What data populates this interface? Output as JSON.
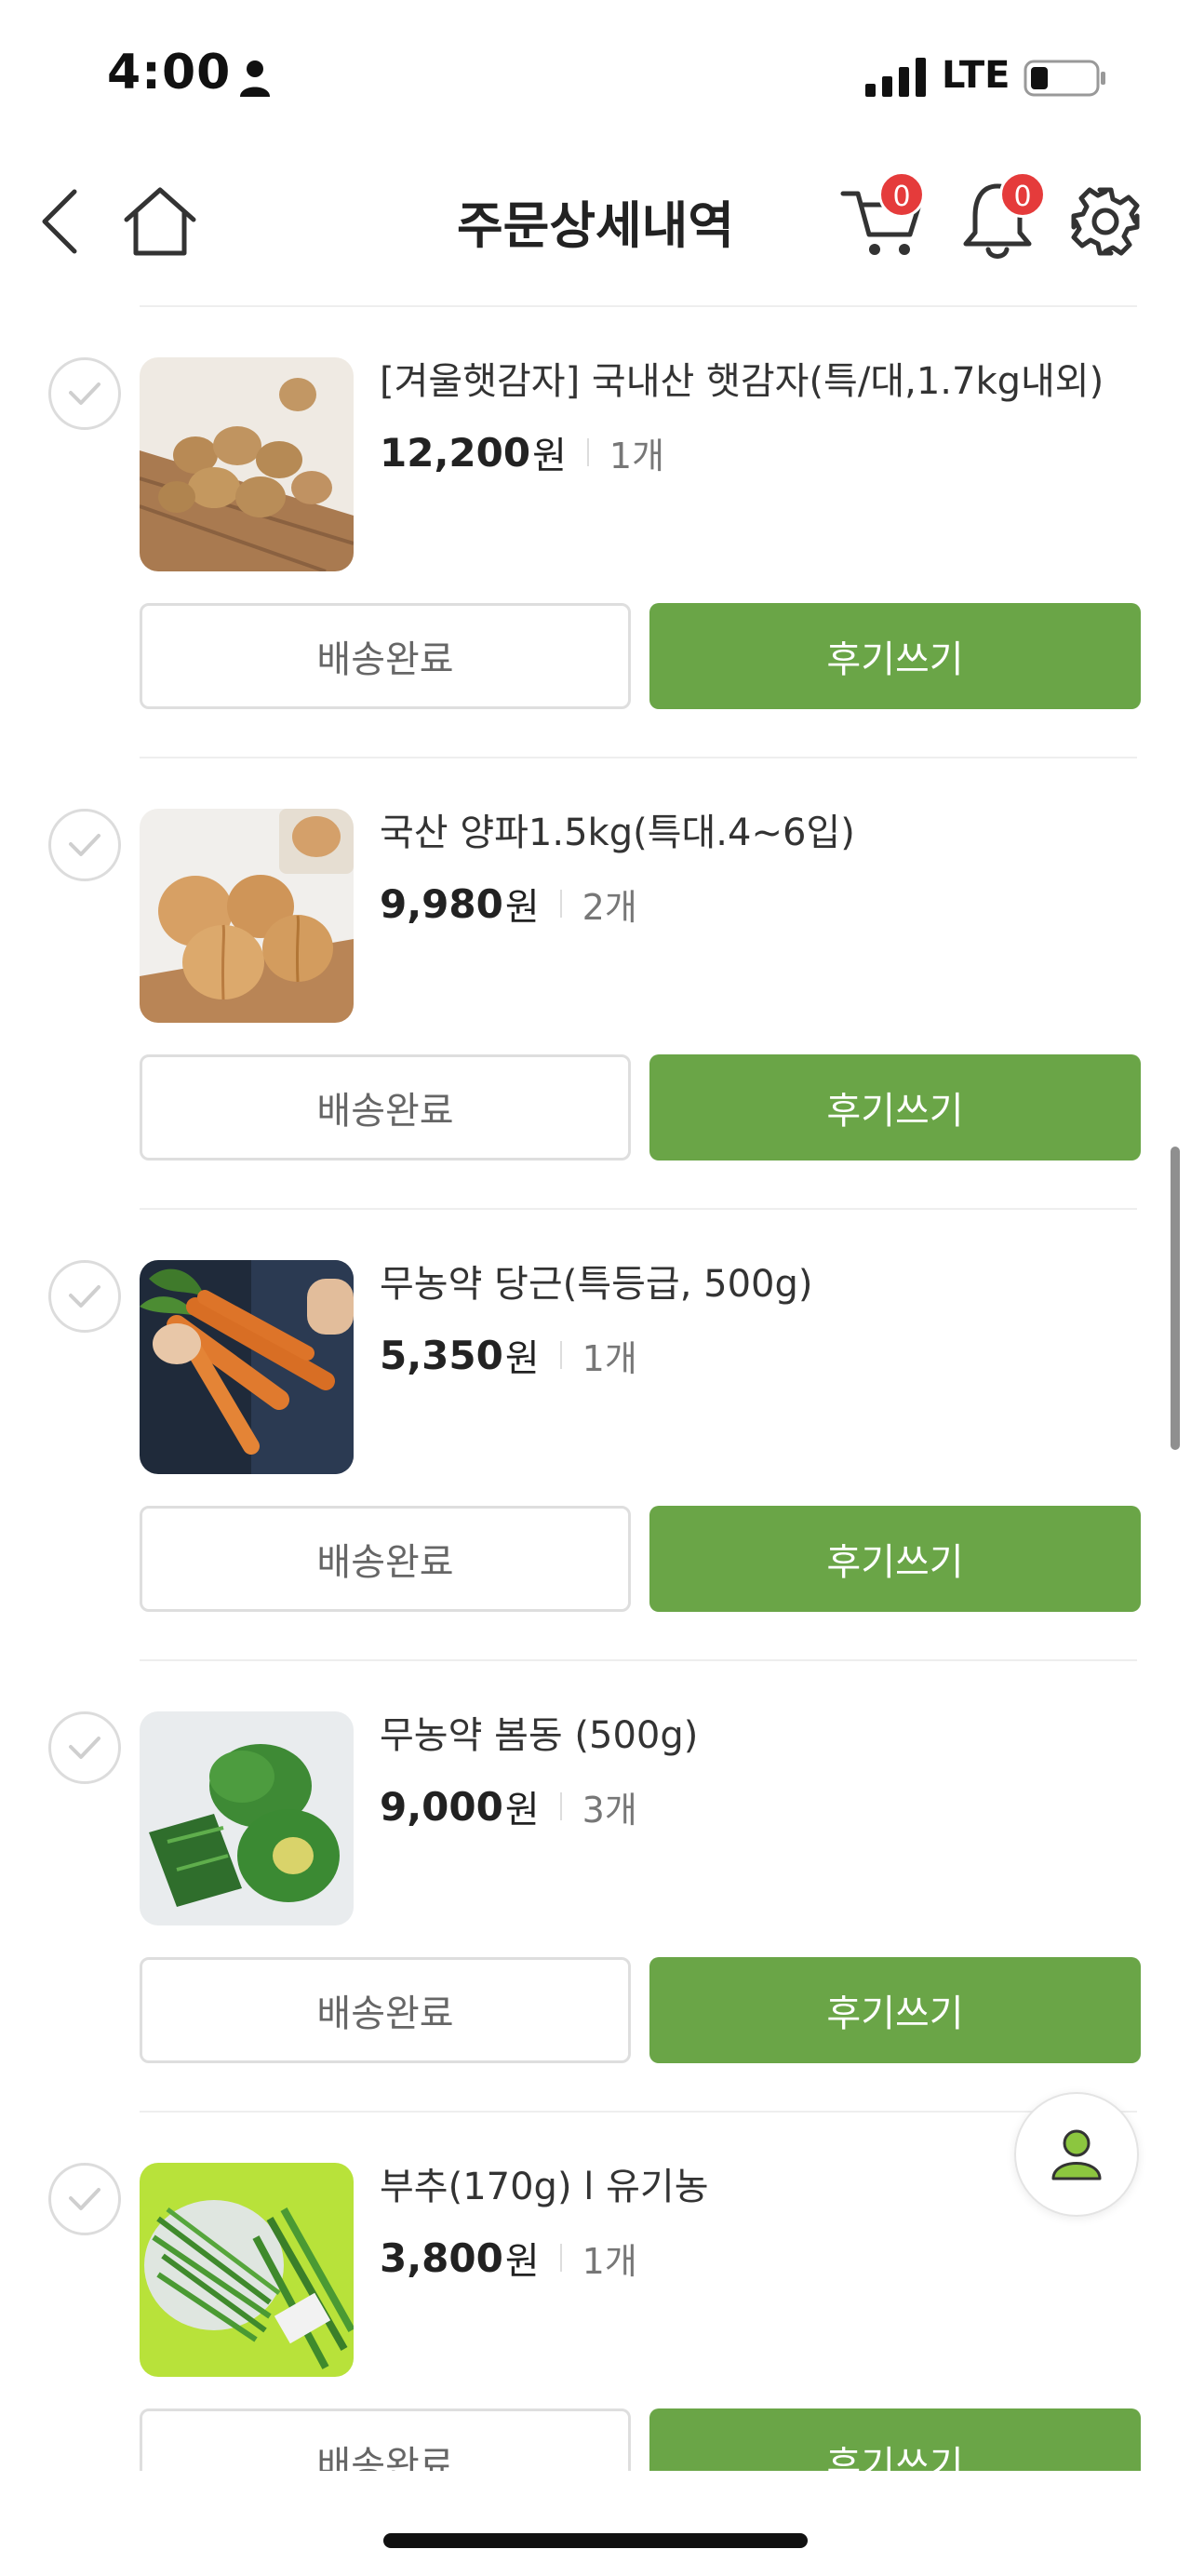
{
  "status_bar": {
    "time": "4:00",
    "network": "LTE",
    "icons": [
      "person-icon",
      "signal-icon",
      "battery-icon"
    ]
  },
  "header": {
    "title": "주문상세내역",
    "cart_count": "0",
    "notification_count": "0",
    "icons": [
      "back-arrow-icon",
      "home-icon",
      "cart-icon",
      "bell-icon",
      "gear-icon"
    ]
  },
  "items": [
    {
      "name": "[겨울햇감자] 국내산 햇감자(특/대,1.7kg내외)",
      "price": "12,200",
      "currency": "원",
      "qty": "1개",
      "status_label": "배송완료",
      "review_label": "후기쓰기",
      "image": "potatoes"
    },
    {
      "name": "국산 양파1.5kg(특대.4~6입)",
      "price": "9,980",
      "currency": "원",
      "qty": "2개",
      "status_label": "배송완료",
      "review_label": "후기쓰기",
      "image": "onions"
    },
    {
      "name": "무농약 당근(특등급, 500g)",
      "price": "5,350",
      "currency": "원",
      "qty": "1개",
      "status_label": "배송완료",
      "review_label": "후기쓰기",
      "image": "carrots"
    },
    {
      "name": "무농약 봄동 (500g)",
      "price": "9,000",
      "currency": "원",
      "qty": "3개",
      "status_label": "배송완료",
      "review_label": "후기쓰기",
      "image": "spring-cabbage"
    },
    {
      "name": "부추(170g) l 유기농",
      "price": "3,800",
      "currency": "원",
      "qty": "1개",
      "status_label": "배송완료",
      "review_label": "후기쓰기",
      "image": "chives"
    }
  ],
  "colors": {
    "accent_green": "#6aa547",
    "badge_red": "#e53b3b",
    "divider": "#eeeeee"
  }
}
